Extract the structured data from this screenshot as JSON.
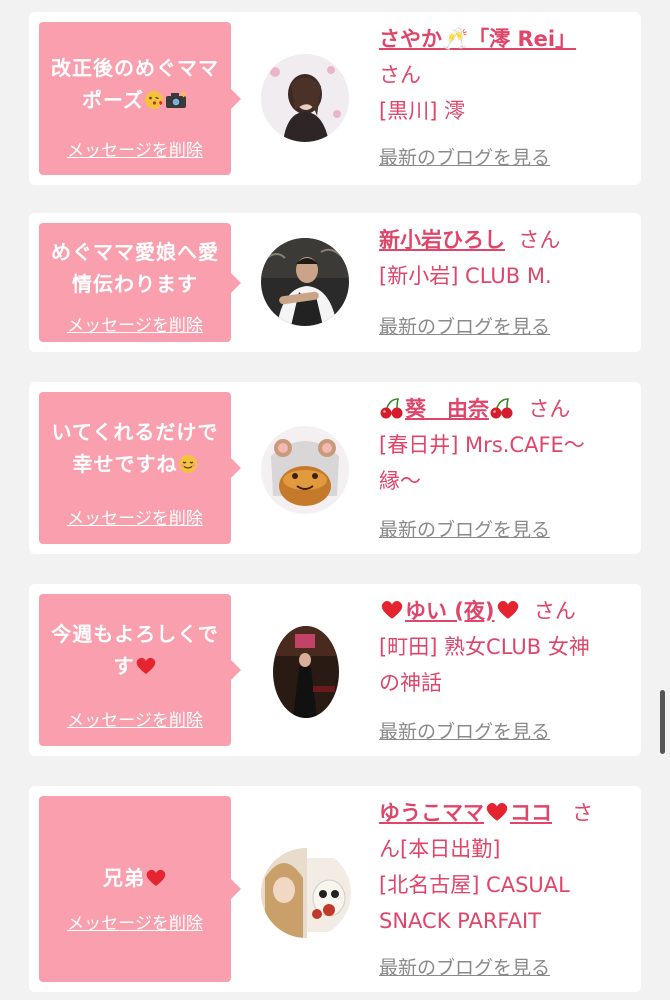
{
  "colors": {
    "accent": "#e0456a",
    "bubble": "#f99fae",
    "link_gray": "#8a8a8a",
    "background": "#f2f2f2",
    "heart": "#e4242e"
  },
  "common": {
    "delete_label": "メッセージを削除",
    "blog_label": "最新のブログを見る"
  },
  "cards": [
    {
      "message_line1": "改正後のめぐママ",
      "message_line2": "ポーズ",
      "message_icons": [
        "kissing-face-icon",
        "camera-flash-icon"
      ],
      "name": "さやか🥂「澪 Rei」",
      "honorific": "さん",
      "shop": "[黒川] 澪"
    },
    {
      "message_line1": "めぐママ愛娘へ愛",
      "message_line2": "情伝わります",
      "name": "新小岩ひろし",
      "honorific": "さん",
      "shop": "[新小岩] CLUB M."
    },
    {
      "message_line1": "いてくれるだけで",
      "message_line2": "幸せですね",
      "message_icons": [
        "relieved-face-icon"
      ],
      "name_prefix_icon": "cherries-icon",
      "name": "葵　由奈",
      "name_suffix_icon": "cherries-icon",
      "honorific": "さん",
      "shop_line1": "[春日井] Mrs.CAFE〜",
      "shop_line2": "縁〜"
    },
    {
      "message_line1": "今週もよろしくで",
      "message_line2": "す",
      "message_icons": [
        "red-heart-icon"
      ],
      "name_prefix_icon": "red-heart-icon",
      "name": "ゆい (夜)",
      "name_suffix_icon": "red-heart-icon",
      "honorific": "さん",
      "shop_line1": "[町田] 熟女CLUB 女神",
      "shop_line2": "の神話"
    },
    {
      "message_line1": "兄弟",
      "message_icons": [
        "red-heart-icon"
      ],
      "name_part1": "ゆうこママ",
      "name_part2": "ココ",
      "name_mid_icon": "red-heart-icon",
      "honorific_a": "さ",
      "honorific_b": "ん[本日出勤]",
      "shop_line1": "[北名古屋] CASUAL",
      "shop_line2": "SNACK PARFAIT"
    }
  ]
}
